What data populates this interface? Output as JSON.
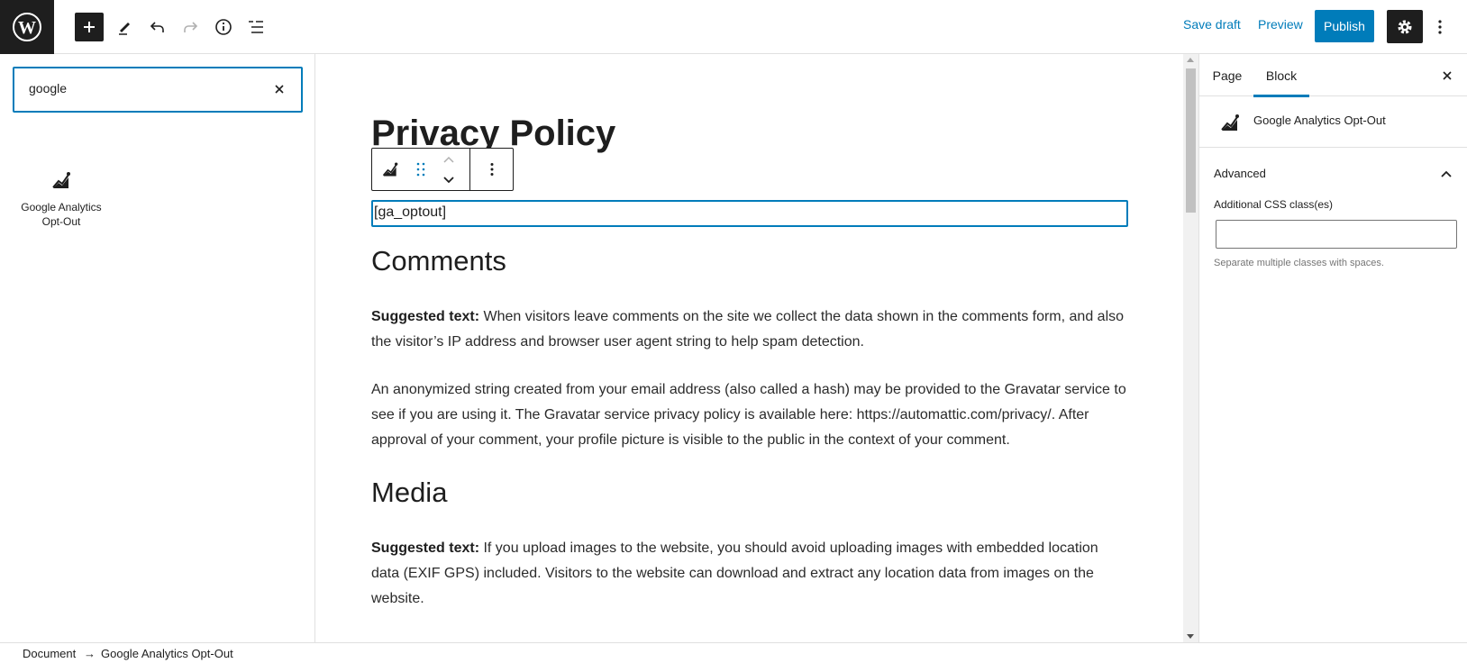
{
  "toolbar": {
    "save_draft": "Save draft",
    "preview": "Preview",
    "publish": "Publish",
    "icons": [
      "wordpress-logo",
      "add-block",
      "edit-tool",
      "undo",
      "redo",
      "details-info",
      "list-view",
      "settings",
      "more-options"
    ],
    "accent": "#007cba"
  },
  "inserter": {
    "search_value": "google",
    "results": [
      {
        "label": "Google Analytics Opt-Out",
        "icon": "chart-icon"
      }
    ]
  },
  "editor": {
    "title": "Privacy Policy",
    "shortcode": "[ga_optout]",
    "sections": [
      {
        "heading": "Comments",
        "paragraphs": [
          {
            "bold": "Suggested text:",
            "text": " When visitors leave comments on the site we collect the data shown in the comments form, and also the visitor’s IP address and browser user agent string to help spam detection."
          },
          {
            "bold": "",
            "text": "An anonymized string created from your email address (also called a hash) may be provided to the Gravatar service to see if you are using it. The Gravatar service privacy policy is available here: https://automattic.com/privacy/. After approval of your comment, your profile picture is visible to the public in the context of your comment."
          }
        ]
      },
      {
        "heading": "Media",
        "paragraphs": [
          {
            "bold": "Suggested text:",
            "text": " If you upload images to the website, you should avoid uploading images with embedded location data (EXIF GPS) included. Visitors to the website can download and extract any location data from images on the website."
          }
        ]
      }
    ]
  },
  "sidebar": {
    "tabs": [
      "Page",
      "Block"
    ],
    "active_tab": "Block",
    "block_name": "Google Analytics Opt-Out",
    "panel_title": "Advanced",
    "field_label": "Additional CSS class(es)",
    "field_value": "",
    "help_text": "Separate multiple classes with spaces."
  },
  "breadcrumb": {
    "items": [
      "Document",
      "Google Analytics Opt-Out"
    ],
    "separator": "→"
  }
}
